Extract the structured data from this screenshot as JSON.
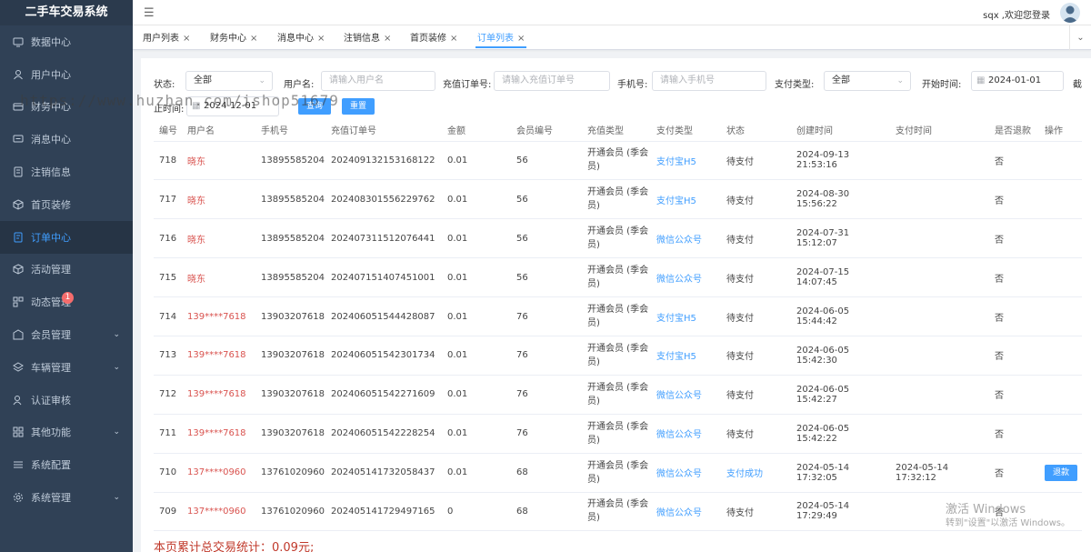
{
  "app": {
    "title": "二手车交易系统"
  },
  "header": {
    "welcome": "sqx ,欢迎您登录"
  },
  "sidebar": {
    "items": [
      {
        "label": "数据中心",
        "icon": "monitor-icon"
      },
      {
        "label": "用户中心",
        "icon": "user-icon"
      },
      {
        "label": "财务中心",
        "icon": "wallet-icon"
      },
      {
        "label": "消息中心",
        "icon": "chat-icon"
      },
      {
        "label": "注销信息",
        "icon": "document-icon"
      },
      {
        "label": "首页装修",
        "icon": "cube-icon"
      },
      {
        "label": "订单中心",
        "icon": "order-icon",
        "active": true
      },
      {
        "label": "活动管理",
        "icon": "cube-icon"
      },
      {
        "label": "动态管理",
        "icon": "dynamic-icon",
        "badge": "1"
      },
      {
        "label": "会员管理",
        "icon": "member-icon",
        "expandable": true
      },
      {
        "label": "车辆管理",
        "icon": "layers-icon",
        "expandable": true
      },
      {
        "label": "认证审核",
        "icon": "user-check-icon"
      },
      {
        "label": "其他功能",
        "icon": "grid-icon",
        "expandable": true
      },
      {
        "label": "系统配置",
        "icon": "list-icon"
      },
      {
        "label": "系统管理",
        "icon": "gear-icon",
        "expandable": true
      }
    ]
  },
  "tabs": [
    {
      "label": "用户列表"
    },
    {
      "label": "财务中心"
    },
    {
      "label": "消息中心"
    },
    {
      "label": "注销信息"
    },
    {
      "label": "首页装修"
    },
    {
      "label": "订单列表",
      "active": true
    }
  ],
  "filters": {
    "status_label": "状态:",
    "status_value": "全部",
    "username_label": "用户名:",
    "username_placeholder": "请输入用户名",
    "order_label": "充值订单号:",
    "order_placeholder": "请输入充值订单号",
    "phone_label": "手机号:",
    "phone_placeholder": "请输入手机号",
    "paytype_label": "支付类型:",
    "paytype_value": "全部",
    "start_label": "开始时间:",
    "start_value": "2024-01-01",
    "end_label_cut": "截",
    "end_label_row2": "止时间:",
    "end_value": "2024-12-01",
    "search_button": "查询",
    "reset_button": "重置"
  },
  "table": {
    "headers": [
      "编号",
      "用户名",
      "手机号",
      "充值订单号",
      "金额",
      "会员编号",
      "充值类型",
      "支付类型",
      "状态",
      "创建时间",
      "支付时间",
      "是否退款",
      "操作"
    ],
    "rows": [
      {
        "id": "718",
        "user": "晓东",
        "phone": "13895585204",
        "order": "202409132153168122",
        "amount": "0.01",
        "member": "56",
        "type": "开通会员 (季会员)",
        "pay": "支付宝H5",
        "status": "待支付",
        "created": "2024-09-13 21:53:16",
        "paid": "",
        "refund": "否",
        "action": ""
      },
      {
        "id": "717",
        "user": "晓东",
        "phone": "13895585204",
        "order": "202408301556229762",
        "amount": "0.01",
        "member": "56",
        "type": "开通会员 (季会员)",
        "pay": "支付宝H5",
        "status": "待支付",
        "created": "2024-08-30 15:56:22",
        "paid": "",
        "refund": "否",
        "action": ""
      },
      {
        "id": "716",
        "user": "晓东",
        "phone": "13895585204",
        "order": "202407311512076441",
        "amount": "0.01",
        "member": "56",
        "type": "开通会员 (季会员)",
        "pay": "微信公众号",
        "status": "待支付",
        "created": "2024-07-31 15:12:07",
        "paid": "",
        "refund": "否",
        "action": ""
      },
      {
        "id": "715",
        "user": "晓东",
        "phone": "13895585204",
        "order": "202407151407451001",
        "amount": "0.01",
        "member": "56",
        "type": "开通会员 (季会员)",
        "pay": "微信公众号",
        "status": "待支付",
        "created": "2024-07-15 14:07:45",
        "paid": "",
        "refund": "否",
        "action": ""
      },
      {
        "id": "714",
        "user": "139****7618",
        "phone": "13903207618",
        "order": "202406051544428087",
        "amount": "0.01",
        "member": "76",
        "type": "开通会员 (季会员)",
        "pay": "支付宝H5",
        "status": "待支付",
        "created": "2024-06-05 15:44:42",
        "paid": "",
        "refund": "否",
        "action": ""
      },
      {
        "id": "713",
        "user": "139****7618",
        "phone": "13903207618",
        "order": "202406051542301734",
        "amount": "0.01",
        "member": "76",
        "type": "开通会员 (季会员)",
        "pay": "支付宝H5",
        "status": "待支付",
        "created": "2024-06-05 15:42:30",
        "paid": "",
        "refund": "否",
        "action": ""
      },
      {
        "id": "712",
        "user": "139****7618",
        "phone": "13903207618",
        "order": "202406051542271609",
        "amount": "0.01",
        "member": "76",
        "type": "开通会员 (季会员)",
        "pay": "微信公众号",
        "status": "待支付",
        "created": "2024-06-05 15:42:27",
        "paid": "",
        "refund": "否",
        "action": ""
      },
      {
        "id": "711",
        "user": "139****7618",
        "phone": "13903207618",
        "order": "202406051542228254",
        "amount": "0.01",
        "member": "76",
        "type": "开通会员 (季会员)",
        "pay": "微信公众号",
        "status": "待支付",
        "created": "2024-06-05 15:42:22",
        "paid": "",
        "refund": "否",
        "action": ""
      },
      {
        "id": "710",
        "user": "137****0960",
        "phone": "13761020960",
        "order": "202405141732058437",
        "amount": "0.01",
        "member": "68",
        "type": "开通会员 (季会员)",
        "pay": "微信公众号",
        "status": "支付成功",
        "created": "2024-05-14 17:32:05",
        "paid": "2024-05-14 17:32:12",
        "refund": "否",
        "action": "退款"
      },
      {
        "id": "709",
        "user": "137****0960",
        "phone": "13761020960",
        "order": "202405141729497165",
        "amount": "0",
        "member": "68",
        "type": "开通会员 (季会员)",
        "pay": "微信公众号",
        "status": "待支付",
        "created": "2024-05-14 17:29:49",
        "paid": "",
        "refund": "否",
        "action": ""
      }
    ]
  },
  "summary": "本页累计总交易统计：0.09元;",
  "overlay": {
    "watermark": "https://www.huzhan.com/ishop51679",
    "activate_title": "激活 Windows",
    "activate_sub": "转到\"设置\"以激活 Windows。"
  },
  "colors": {
    "sidebar_bg": "#304156",
    "accent": "#409eff",
    "user_link": "#d9534f"
  }
}
